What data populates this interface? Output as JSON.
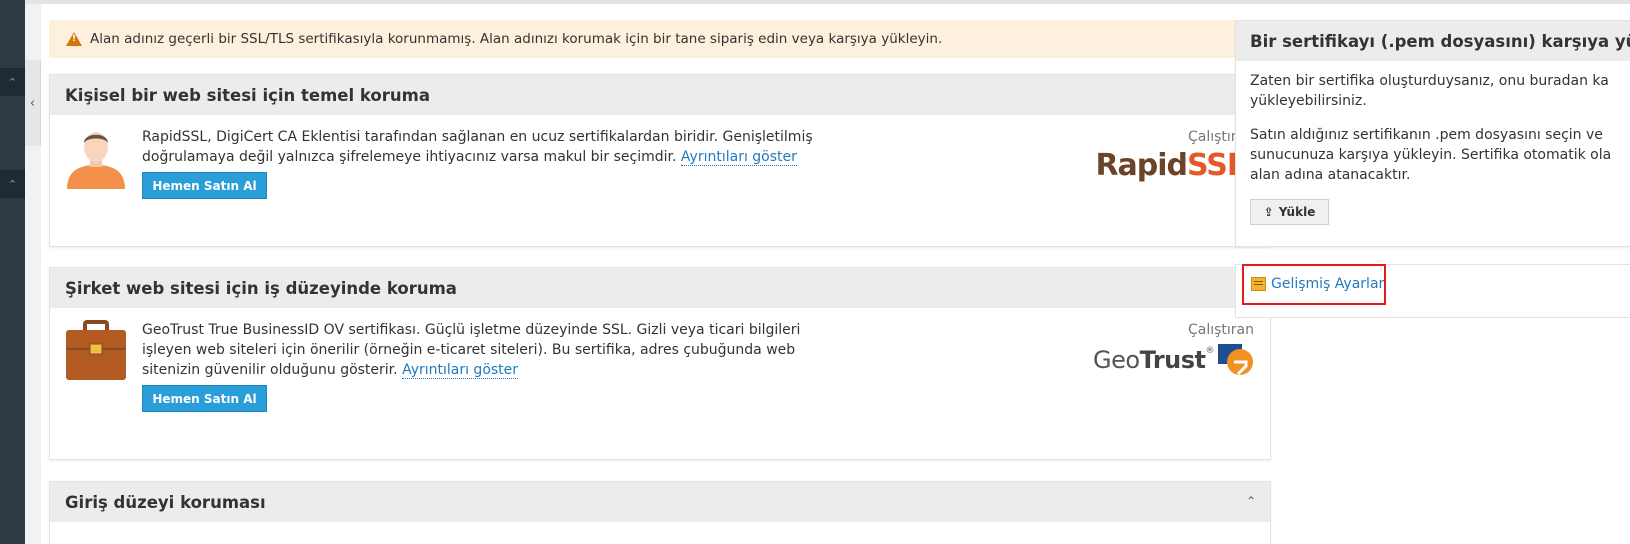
{
  "alert": {
    "icon": "warning-icon",
    "text": "Alan adınız geçerli bir SSL/TLS sertifikasıyla korunmamış. Alan adınızı korumak için bir tane sipariş edin veya karşıya yükleyin."
  },
  "cards": [
    {
      "title": "Kişisel bir web sitesi için temel koruma",
      "description": "RapidSSL, DigiCert CA Eklentisi tarafından sağlanan en ucuz sertifikalardan biridir. Genişletilmiş doğrulamaya değil yalnızca şifrelemeye ihtiyacınız varsa makul bir seçimdir.",
      "details_link": "Ayrıntıları göster",
      "buy_label": "Hemen Satın Al",
      "provider_label": "Çalıştıran",
      "provider_logo_a": "Rapid",
      "provider_logo_b": "SSL",
      "provider_logo_reg": "®"
    },
    {
      "title": "Şirket web sitesi için iş düzeyinde koruma",
      "description": "GeoTrust True BusinessID OV sertifikası. Güçlü işletme düzeyinde SSL. Gizli veya ticari bilgileri işleyen web siteleri için önerilir (örneğin e-ticaret siteleri). Bu sertifika, adres çubuğunda web sitenizin güvenilir olduğunu gösterir.",
      "details_link": "Ayrıntıları göster",
      "buy_label": "Hemen Satın Al",
      "provider_label": "Çalıştıran",
      "provider_logo_a": "Geo",
      "provider_logo_b": "Trust",
      "provider_logo_reg": "®"
    },
    {
      "title": "Giriş düzeyi koruması"
    }
  ],
  "upload_panel": {
    "title": "Bir sertifikayı (.pem dosyasını) karşıya yükle",
    "p1_line1": "Zaten bir sertifika oluşturduysanız, onu buradan ka",
    "p1_line2": "yükleyebilirsiniz.",
    "p2_line1": "Satın aldığınız sertifikanın .pem dosyasını seçin ve",
    "p2_line2": "sunucunuza karşıya yükleyin. Sertifika otomatik ola",
    "p2_line3": "alan adına atanacaktır.",
    "upload_label": "Yükle"
  },
  "advanced": {
    "label": "Gelişmiş Ayarlar",
    "icon": "settings-list-icon"
  },
  "colors": {
    "accent": "#2a9ed8",
    "link": "#1e7bbf",
    "warning": "#d8730d",
    "highlight": "#e41b1b"
  }
}
